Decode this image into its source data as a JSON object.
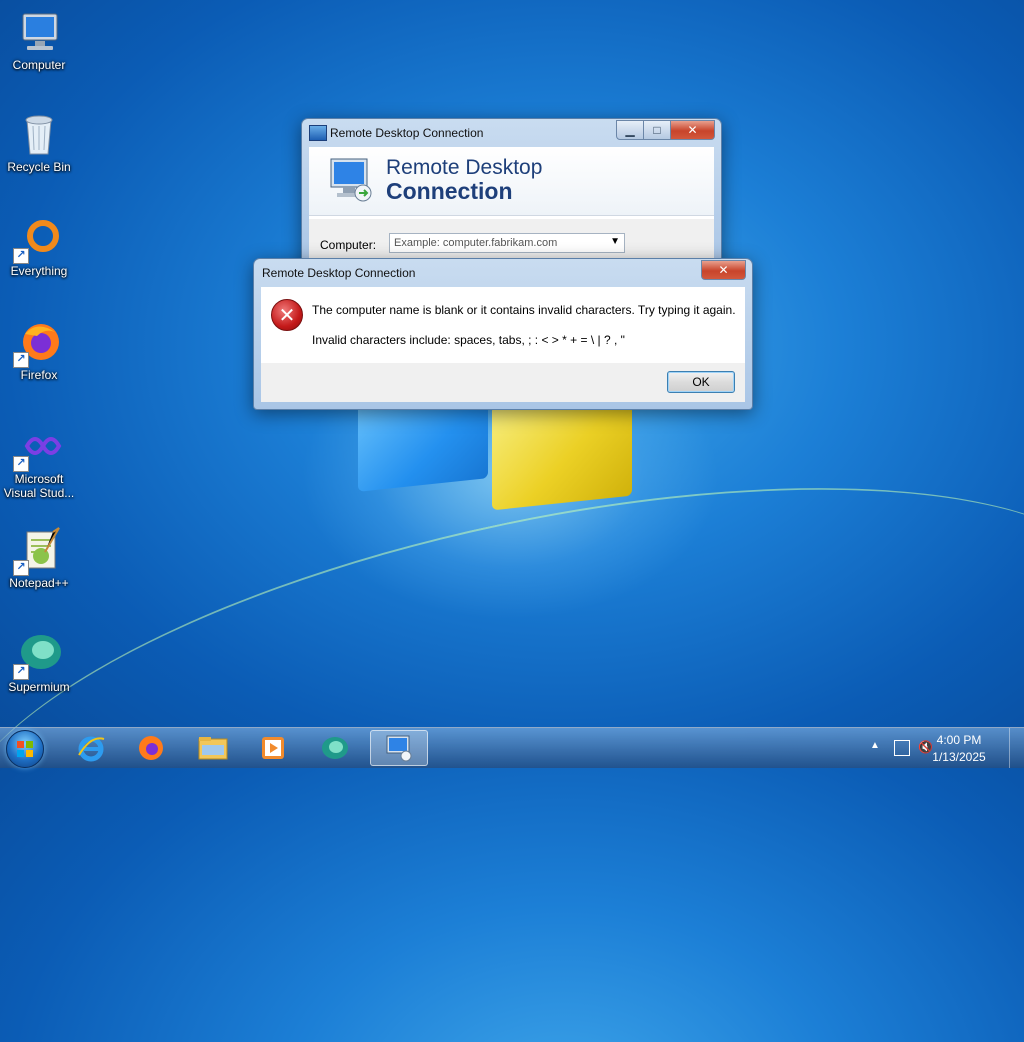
{
  "desktop": {
    "icons": [
      {
        "label": "Computer",
        "icon": "computer-icon"
      },
      {
        "label": "Recycle Bin",
        "icon": "recycle-bin-icon"
      },
      {
        "label": "Everything",
        "icon": "everything-icon"
      },
      {
        "label": "Firefox",
        "icon": "firefox-icon"
      },
      {
        "label": "Microsoft Visual Stud...",
        "icon": "visual-studio-icon"
      },
      {
        "label": "Notepad++",
        "icon": "notepadpp-icon"
      },
      {
        "label": "Supermium",
        "icon": "supermium-icon"
      }
    ]
  },
  "rdc_window": {
    "title": "Remote Desktop Connection",
    "banner_line1": "Remote Desktop",
    "banner_line2": "Connection",
    "computer_label": "Computer:",
    "computer_placeholder": "Example: computer.fabrikam.com"
  },
  "error_dialog": {
    "title": "Remote Desktop Connection",
    "message1": "The computer name is blank or it contains invalid characters. Try typing it again.",
    "message2": "Invalid characters include: spaces, tabs, ; : < > * + = \\ | ? , \"",
    "ok_label": "OK"
  },
  "taskbar": {
    "pinned": [
      "internet-explorer-icon",
      "firefox-icon",
      "file-explorer-icon",
      "media-player-icon",
      "supermium-icon",
      "remote-desktop-icon"
    ],
    "time": "4:00 PM",
    "date": "1/13/2025"
  }
}
